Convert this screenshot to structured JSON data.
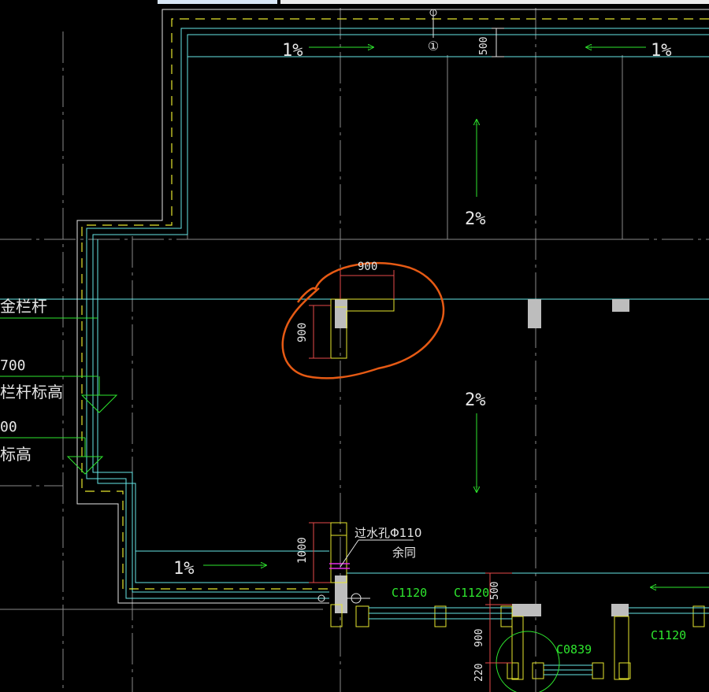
{
  "slope_labels": {
    "top_left": "1%",
    "top_right": "1%",
    "center_upper": "2%",
    "center_lower": "2%",
    "bottom_left": "1%"
  },
  "dimensions": {
    "top_500": "500",
    "circled_900_horizontal": "900",
    "circled_900_vertical": "900",
    "dim_1000": "1000",
    "dim_500_bottom": "500",
    "dim_900_bottom": "900",
    "dim_220": "220"
  },
  "notes": {
    "drain_hole": "过水孔Φ110",
    "drain_hole_sub": "余同"
  },
  "left_labels": {
    "railing": "金栏杆",
    "elev_700": "700",
    "railing_height": "栏杆标高",
    "elev_00": "00",
    "height": "标高"
  },
  "windows": {
    "c1120_a": "C1120",
    "c1120_b": "C1120",
    "c1120_c": "C1120",
    "c0839": "C0839"
  },
  "axis_markers": {
    "top_axis": "①"
  },
  "colors": {
    "background": "#000000",
    "wall_cyan": "#66e6e6",
    "grid_gray": "#8a8a8a",
    "column_gray": "#bdbdbd",
    "dashed_yellow": "#e6e62e",
    "annotation_green": "#2ee62e",
    "dimension_red": "#e64a4a",
    "highlight_orange": "#e65a14",
    "cad_white": "#e6e6e6"
  }
}
